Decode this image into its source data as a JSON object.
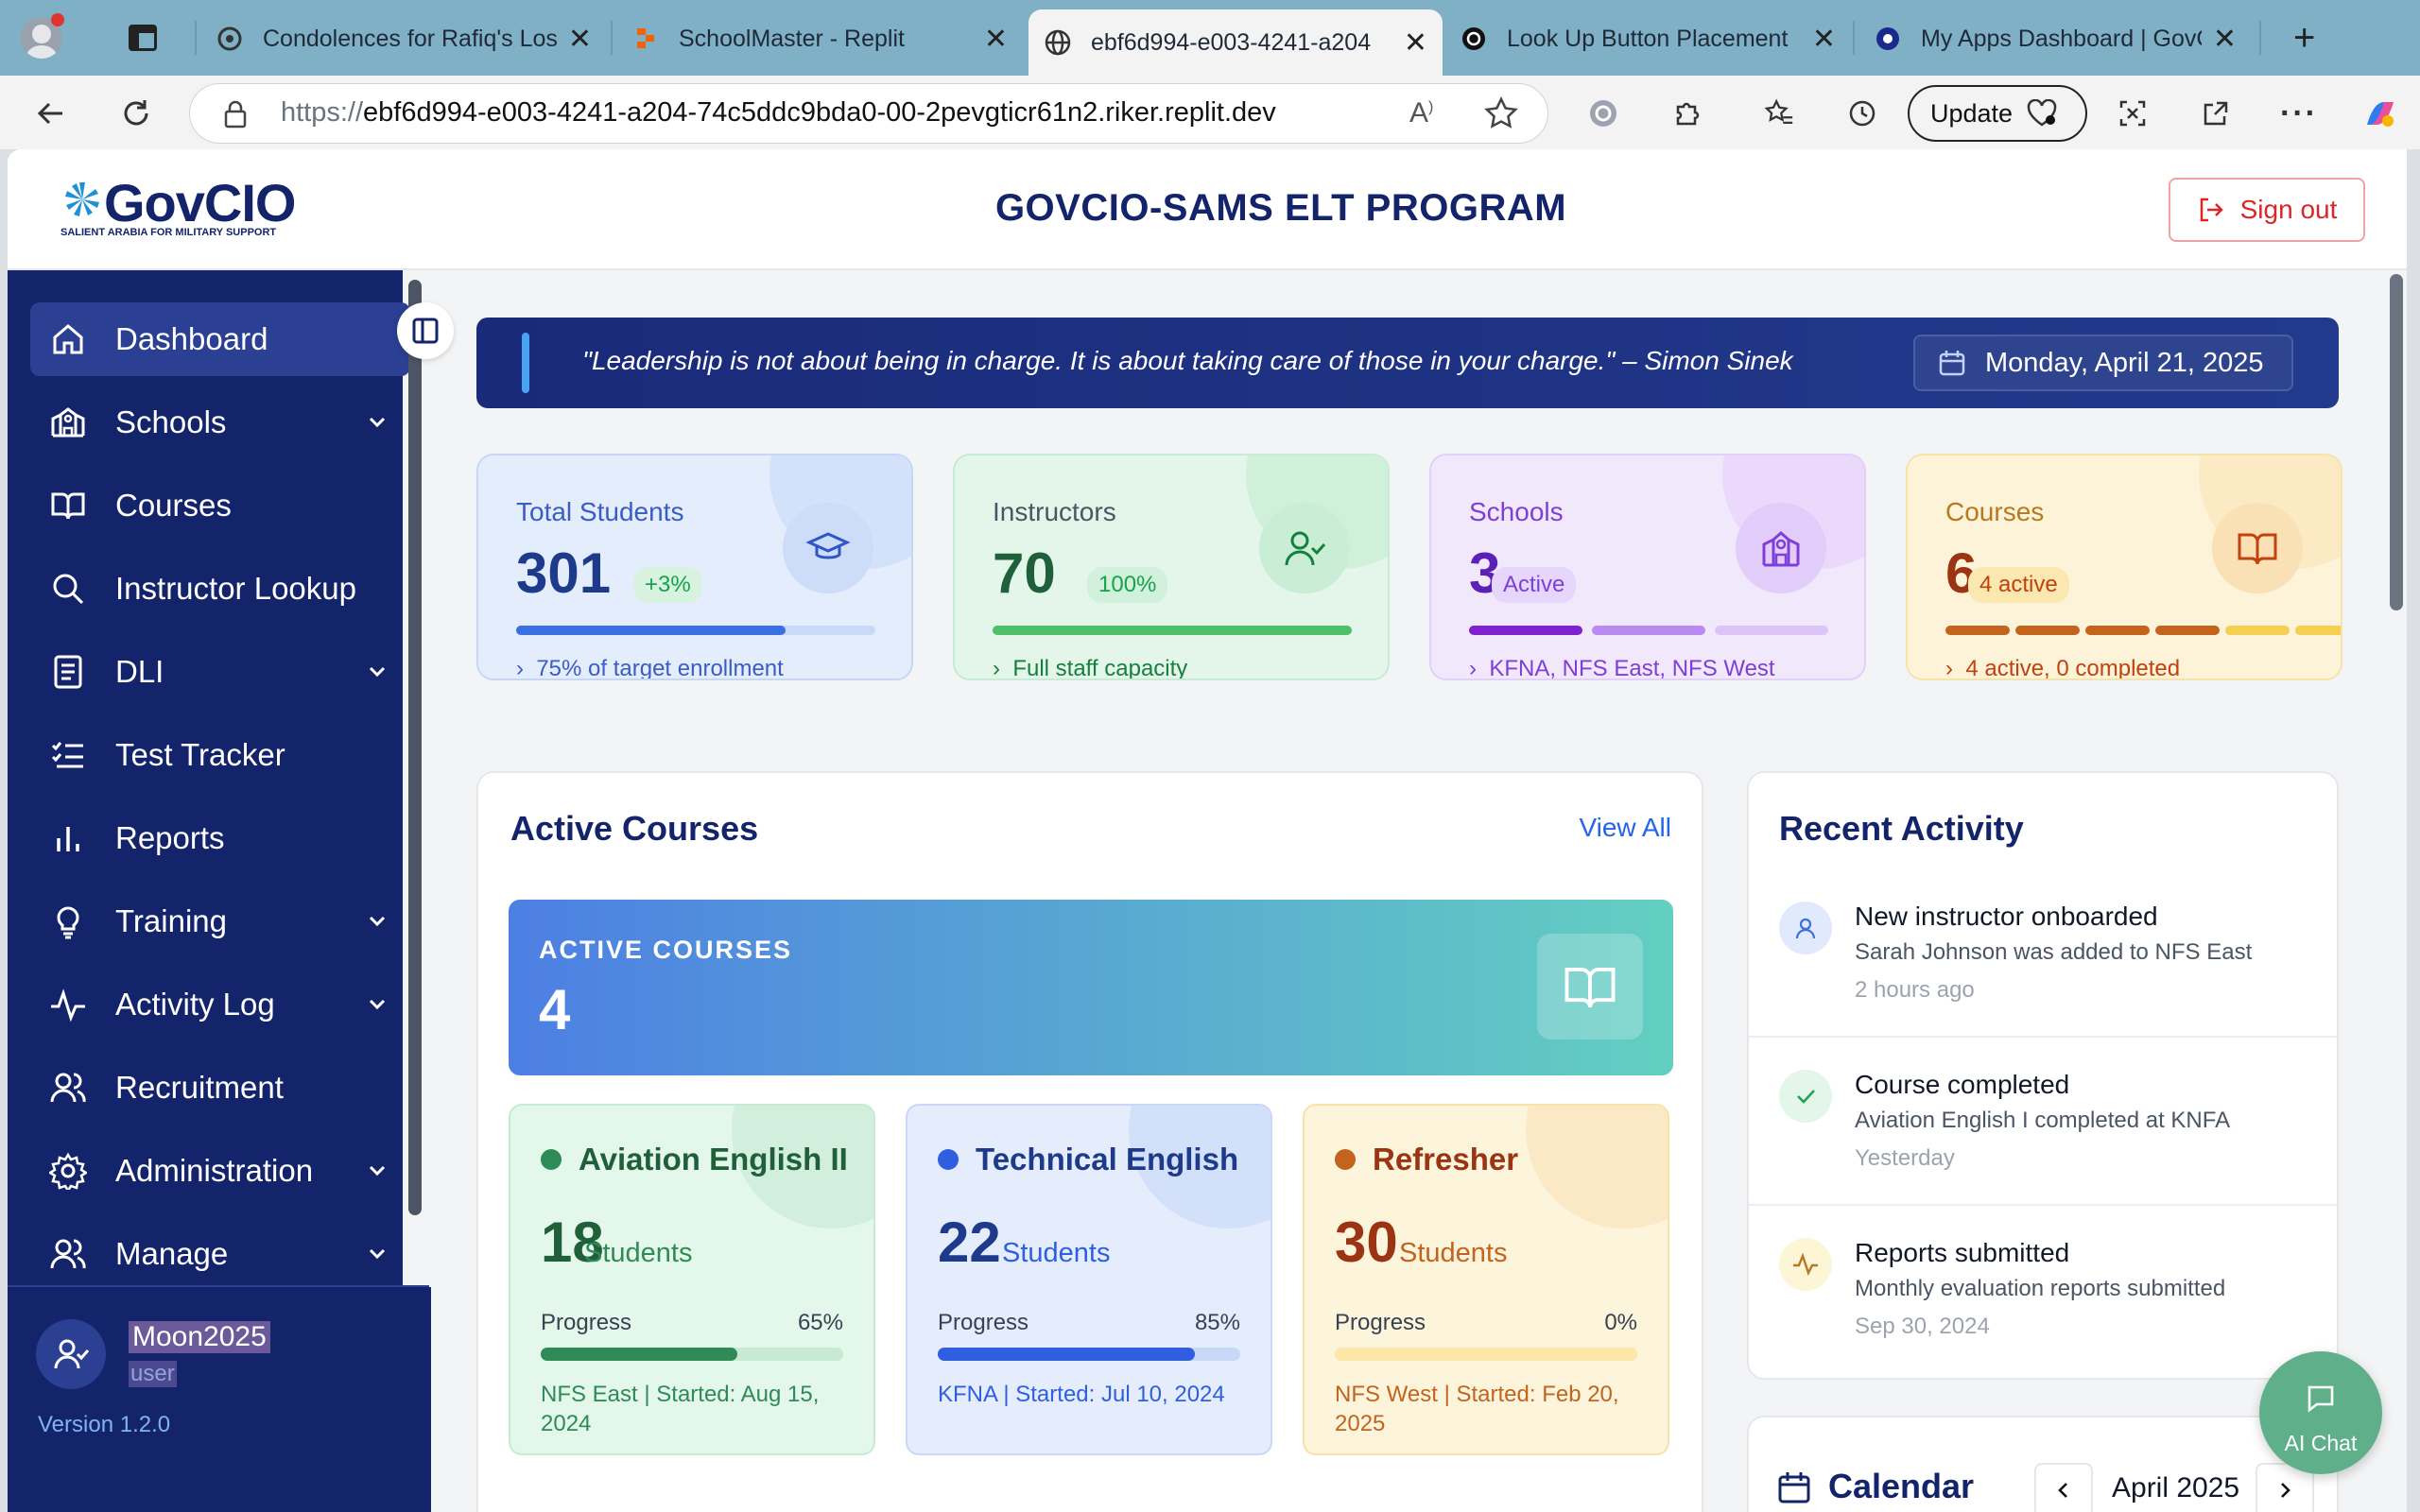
{
  "browser": {
    "tabs": [
      {
        "title": "Condolences for Rafiq's Los",
        "icon": "chatgpt-icon"
      },
      {
        "title": "SchoolMaster - Replit",
        "icon": "replit-icon"
      },
      {
        "title": "ebf6d994-e003-4241-a204",
        "icon": "globe-icon",
        "active": true
      },
      {
        "title": "Look Up Button Placement",
        "icon": "chatgpt-icon"
      },
      {
        "title": "My Apps Dashboard | GovCl",
        "icon": "okta-icon"
      }
    ],
    "url_prefix": "https://",
    "url_host": "ebf6d994-e003-4241-a204-74c5ddc9bda0-00-2pevgticr61n2.riker.replit.dev",
    "update_label": "Update"
  },
  "header": {
    "logo_text": "GovCIO",
    "logo_subtitle": "SALIENT ARABIA FOR MILITARY SUPPORT",
    "title": "GOVCIO-SAMS ELT PROGRAM",
    "signout_label": "Sign out"
  },
  "sidebar": {
    "items": [
      {
        "label": "Dashboard",
        "icon": "home-icon"
      },
      {
        "label": "Schools",
        "icon": "school-icon"
      },
      {
        "label": "Courses",
        "icon": "book-icon"
      },
      {
        "label": "Instructor Lookup",
        "icon": "search-icon"
      },
      {
        "label": "DLI",
        "icon": "document-icon"
      },
      {
        "label": "Test Tracker",
        "icon": "checklist-icon"
      },
      {
        "label": "Reports",
        "icon": "bar-chart-icon"
      },
      {
        "label": "Training",
        "icon": "lightbulb-icon"
      },
      {
        "label": "Activity Log",
        "icon": "activity-icon"
      },
      {
        "label": "Recruitment",
        "icon": "users-icon"
      },
      {
        "label": "Administration",
        "icon": "gear-icon"
      },
      {
        "label": "Manage",
        "icon": "users-icon"
      }
    ],
    "user": {
      "name": "Moon2025",
      "role": "user"
    },
    "version": "Version 1.2.0"
  },
  "quote": {
    "text": "\"Leadership is not about being in charge. It is about taking care of those in your charge.\" – Simon Sinek",
    "date": "Monday, April 21, 2025"
  },
  "stats": [
    {
      "label": "Total Students",
      "value": "301",
      "pill": "+3%",
      "footer": "75% of target enrollment",
      "icon": "graduation-cap-icon",
      "progress": 0.75
    },
    {
      "label": "Instructors",
      "value": "70",
      "pill": "100%",
      "footer": "Full staff capacity",
      "icon": "user-check-icon",
      "progress": 1.0
    },
    {
      "label": "Schools",
      "value": "3",
      "pill": "Active",
      "footer": "KFNA, NFS East, NFS West",
      "icon": "school-icon",
      "segments": 3
    },
    {
      "label": "Courses",
      "value": "6",
      "pill": "4 active",
      "footer": "4 active, 0 completed",
      "icon": "book-icon",
      "segments": 6
    }
  ],
  "active_courses": {
    "title": "Active Courses",
    "view_all": "View All",
    "banner_label": "ACTIVE COURSES",
    "banner_value": "4",
    "courses": [
      {
        "name": "Aviation English II",
        "count": "18",
        "unit": "Students",
        "progress_label": "Progress",
        "progress_text": "65%",
        "progress": 0.65,
        "meta": "NFS East | Started: Aug 15, 2024"
      },
      {
        "name": "Technical English",
        "count": "22",
        "unit": "Students",
        "progress_label": "Progress",
        "progress_text": "85%",
        "progress": 0.85,
        "meta": "KFNA | Started: Jul 10, 2024"
      },
      {
        "name": "Refresher",
        "count": "30",
        "unit": "Students",
        "progress_label": "Progress",
        "progress_text": "0%",
        "progress": 0.0,
        "meta": "NFS West | Started: Feb 20, 2025"
      }
    ]
  },
  "recent_activity": {
    "title": "Recent Activity",
    "items": [
      {
        "title": "New instructor onboarded",
        "desc": "Sarah Johnson was added to NFS East",
        "when": "2 hours ago",
        "icon": "user-icon"
      },
      {
        "title": "Course completed",
        "desc": "Aviation English I completed at KNFA",
        "when": "Yesterday",
        "icon": "check-icon"
      },
      {
        "title": "Reports submitted",
        "desc": "Monthly evaluation reports submitted",
        "when": "Sep 30, 2024",
        "icon": "activity-icon"
      }
    ]
  },
  "calendar": {
    "title": "Calendar",
    "month": "April 2025"
  },
  "ai_chat": {
    "label": "AI Chat"
  }
}
